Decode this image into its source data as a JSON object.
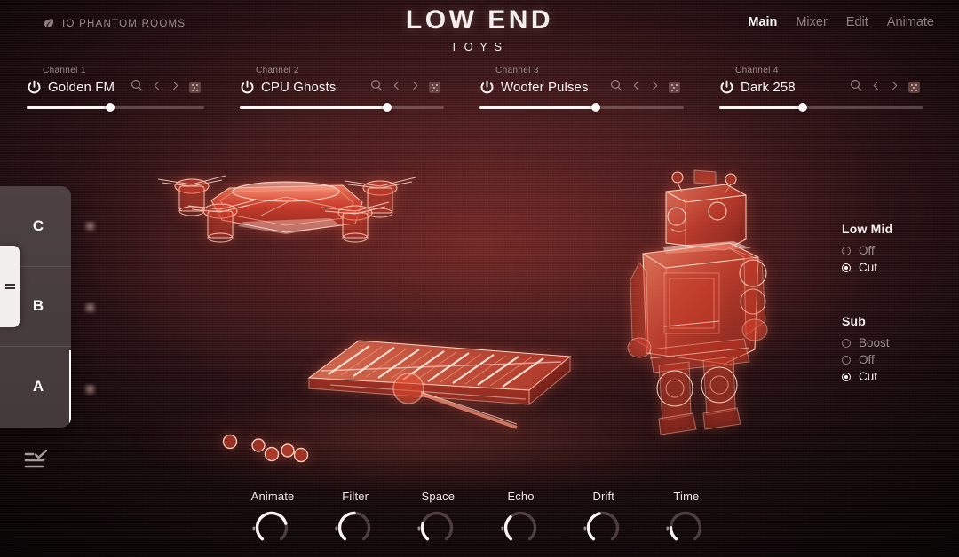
{
  "app": {
    "brand": "IO PHANTOM ROOMS",
    "brand_icon": "leaf-icon",
    "title_line1": "LOW END",
    "title_line2": "TOYS"
  },
  "nav": {
    "items": [
      {
        "label": "Main",
        "active": true
      },
      {
        "label": "Mixer",
        "active": false
      },
      {
        "label": "Edit",
        "active": false
      },
      {
        "label": "Animate",
        "active": false
      }
    ]
  },
  "channels": [
    {
      "label": "Channel 1",
      "name": "Golden FM",
      "power_icon": "power-icon",
      "search_icon": "search-icon",
      "prev_icon": "chevron-left-icon",
      "next_icon": "chevron-right-icon",
      "random_icon": "dice-icon",
      "level": 47
    },
    {
      "label": "Channel 2",
      "name": "CPU Ghosts",
      "power_icon": "power-icon",
      "search_icon": "search-icon",
      "prev_icon": "chevron-left-icon",
      "next_icon": "chevron-right-icon",
      "random_icon": "dice-icon",
      "level": 72
    },
    {
      "label": "Channel 3",
      "name": "Woofer Pulses",
      "power_icon": "power-icon",
      "search_icon": "search-icon",
      "prev_icon": "chevron-left-icon",
      "next_icon": "chevron-right-icon",
      "random_icon": "dice-icon",
      "level": 57
    },
    {
      "label": "Channel 4",
      "name": "Dark 258",
      "power_icon": "power-icon",
      "search_icon": "search-icon",
      "prev_icon": "chevron-left-icon",
      "next_icon": "chevron-right-icon",
      "random_icon": "dice-icon",
      "level": 41
    }
  ],
  "sidebar": {
    "sections": [
      {
        "label": "C",
        "active": false
      },
      {
        "label": "B",
        "active": false
      },
      {
        "label": "A",
        "active": true
      }
    ],
    "drawer_tab_icon": "hamburger-icon",
    "list_check_icon": "list-check-icon"
  },
  "right_panel": {
    "groups": [
      {
        "title": "Low Mid",
        "options": [
          {
            "label": "Off",
            "selected": false
          },
          {
            "label": "Cut",
            "selected": true
          }
        ]
      },
      {
        "title": "Sub",
        "options": [
          {
            "label": "Boost",
            "selected": false
          },
          {
            "label": "Off",
            "selected": false
          },
          {
            "label": "Cut",
            "selected": true
          }
        ]
      }
    ]
  },
  "knobs": [
    {
      "label": "Animate",
      "value": 76
    },
    {
      "label": "Filter",
      "value": 50
    },
    {
      "label": "Space",
      "value": 24
    },
    {
      "label": "Echo",
      "value": 35
    },
    {
      "label": "Drift",
      "value": 45
    },
    {
      "label": "Time",
      "value": 18
    }
  ],
  "stage": {
    "holograms": [
      {
        "name": "drone-hologram",
        "subject": "quadcopter drone"
      },
      {
        "name": "xylophone-hologram",
        "subject": "toy xylophone with mallet"
      },
      {
        "name": "robot-hologram",
        "subject": "tin toy robot"
      },
      {
        "name": "marbles-hologram",
        "subject": "five marbles"
      }
    ]
  },
  "colors": {
    "accent": "#e8543c",
    "hologram": "#ff6a4a",
    "text_primary": "#f7f1ef",
    "text_dim": "#9b8c8c",
    "panel": "#4d4141",
    "background": "#2a1114"
  }
}
